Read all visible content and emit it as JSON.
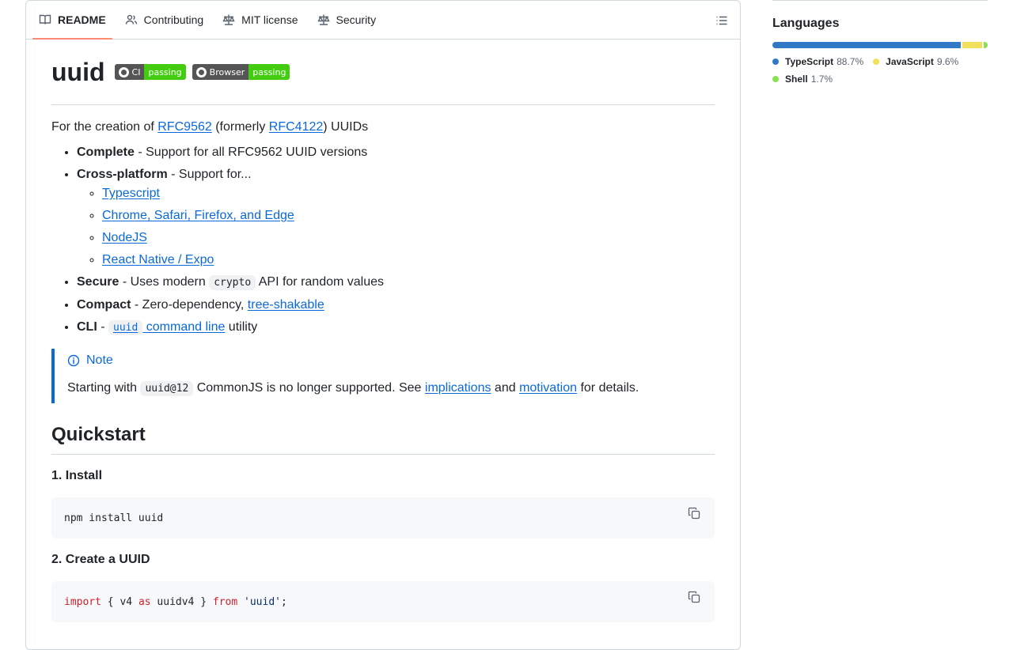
{
  "tabs": [
    {
      "label": "README",
      "icon": "book-icon",
      "active": true
    },
    {
      "label": "Contributing",
      "icon": "people-icon"
    },
    {
      "label": "MIT license",
      "icon": "law-icon"
    },
    {
      "label": "Security",
      "icon": "law-icon"
    }
  ],
  "readme": {
    "title": "uuid",
    "badges": [
      {
        "label": "CI",
        "status": "passing"
      },
      {
        "label": "Browser",
        "status": "passing"
      }
    ],
    "intro": {
      "prefix": "For the creation of ",
      "link1": "RFC9562",
      "middle": " (formerly ",
      "link2": "RFC4122",
      "suffix": ") UUIDs"
    },
    "features": {
      "complete_bold": "Complete",
      "complete_text": " - Support for all RFC9562 UUID versions",
      "cross_bold": "Cross-platform",
      "cross_text": " - Support for...",
      "platforms": [
        "Typescript",
        "Chrome, Safari, Firefox, and Edge",
        "NodeJS",
        "React Native / Expo"
      ],
      "secure_bold": "Secure",
      "secure_pre": " - Uses modern ",
      "secure_code": "crypto",
      "secure_post": " API for random values",
      "compact_bold": "Compact",
      "compact_pre": " - Zero-dependency, ",
      "compact_link": "tree-shakable",
      "cli_bold": "CLI",
      "cli_pre": " - ",
      "cli_code": "uuid",
      "cli_link": " command line",
      "cli_post": " utility"
    },
    "note": {
      "title": "Note",
      "pre": "Starting with ",
      "code": "uuid@12",
      "mid": " CommonJS is no longer supported. See ",
      "link1": "implications",
      "and": " and ",
      "link2": "motivation",
      "post": " for details."
    },
    "quickstart": {
      "heading": "Quickstart",
      "step1": "1. Install",
      "step1_code": "npm install uuid",
      "step2": "2. Create a UUID",
      "step2_code": {
        "kw1": "import",
        "p1": " { v4 ",
        "kw2": "as",
        "p2": " uuidv4 } ",
        "kw3": "from",
        "p3": " ",
        "str": "'uuid'",
        "p4": ";"
      }
    }
  },
  "sidebar": {
    "languages_heading": "Languages",
    "languages": [
      {
        "name": "TypeScript",
        "percent": "88.7%",
        "value": 88.7,
        "color": "#3178c6"
      },
      {
        "name": "JavaScript",
        "percent": "9.6%",
        "value": 9.6,
        "color": "#f1e05a"
      },
      {
        "name": "Shell",
        "percent": "1.7%",
        "value": 1.7,
        "color": "#89e051"
      }
    ]
  }
}
